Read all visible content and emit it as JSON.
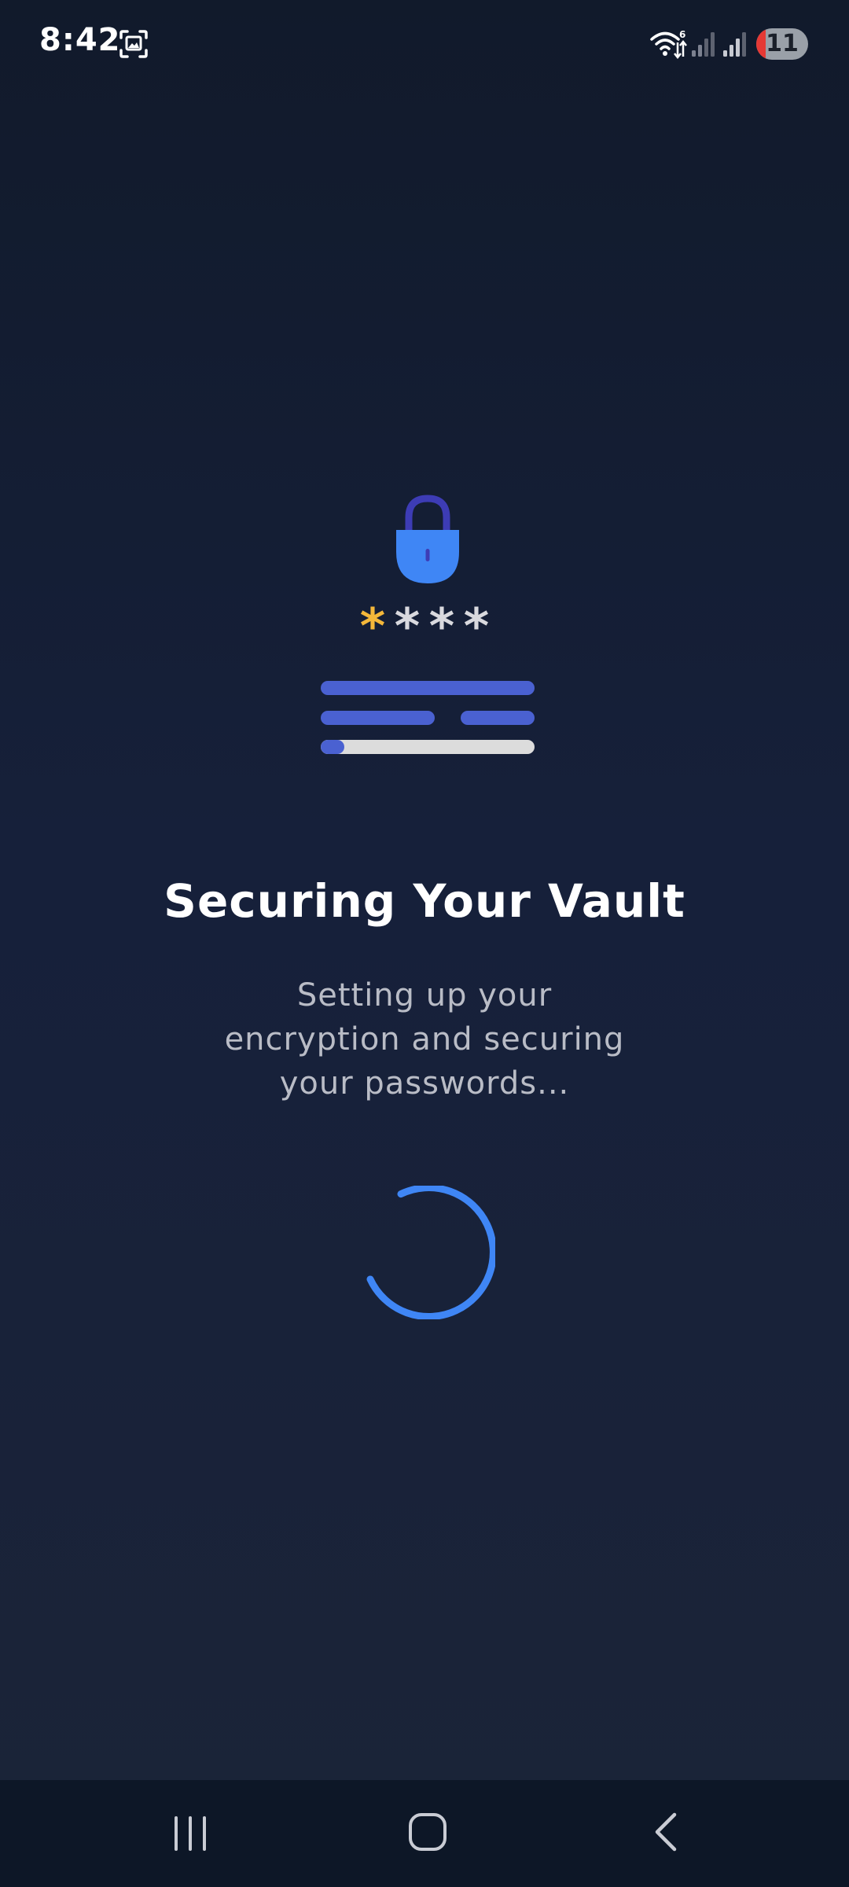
{
  "status_bar": {
    "time": "8:42",
    "battery_level": "11",
    "icons": [
      "screenshot-icon",
      "wifi-icon",
      "signal-icon",
      "signal-icon",
      "battery-icon"
    ]
  },
  "hero": {
    "lock_icon": "lock-icon",
    "password_mask": {
      "accent_char": "*",
      "hidden_chars": [
        "*",
        "*",
        "*"
      ]
    },
    "progress_fraction": 0.11
  },
  "main": {
    "title": "Securing Your Vault",
    "subtitle": "Setting up your encryption and securing your passwords..."
  },
  "spinner": {
    "icon": "loading-spinner"
  },
  "nav_bar": {
    "items": [
      "recents-icon",
      "home-icon",
      "back-icon"
    ]
  },
  "colors": {
    "background_top": "#111a2b",
    "background_bottom": "#1b2438",
    "accent_blue": "#4a61d1",
    "lock_blue": "#3f86f5",
    "shackle_indigo": "#3d3cb5",
    "star_accent": "#f4b73a",
    "spinner_blue": "#3f86f5",
    "nav_background": "#0d1727"
  }
}
